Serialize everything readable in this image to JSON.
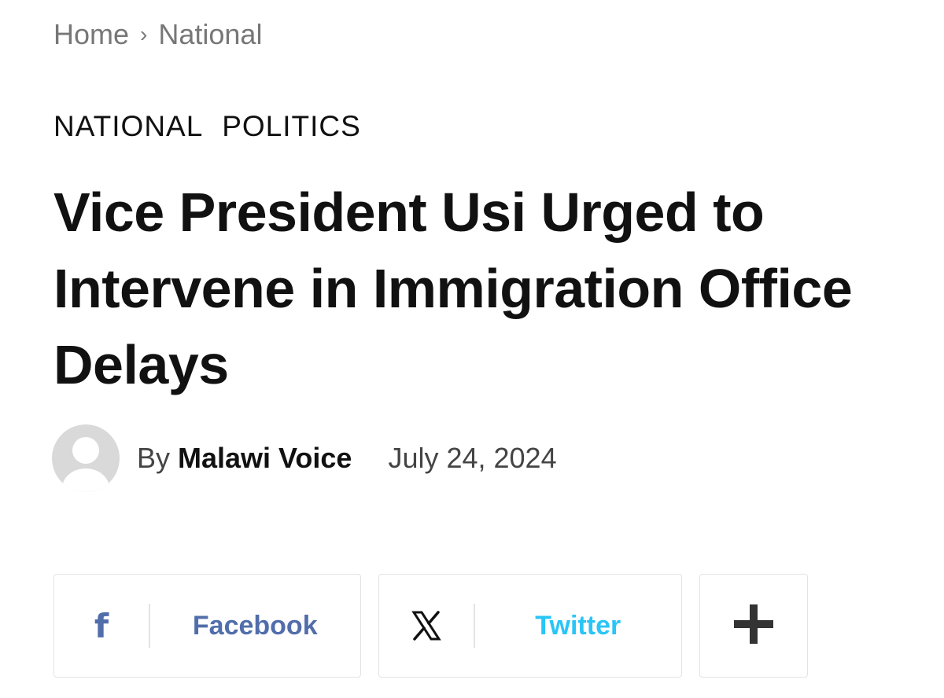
{
  "breadcrumb": {
    "home": "Home",
    "separator": "›",
    "current": "National"
  },
  "categories": [
    "NATIONAL",
    "POLITICS"
  ],
  "article": {
    "title": "Vice President Usi Urged to Intervene in Immigration Office Delays",
    "by_label": "By",
    "author": "Malawi Voice",
    "date": "July 24, 2024"
  },
  "share": {
    "facebook": {
      "icon": "facebook-icon",
      "label": "Facebook",
      "color": "#516eab"
    },
    "twitter": {
      "icon": "x-icon",
      "label": "Twitter",
      "color": "#29c5f6"
    },
    "more": {
      "icon": "plus-icon"
    }
  }
}
